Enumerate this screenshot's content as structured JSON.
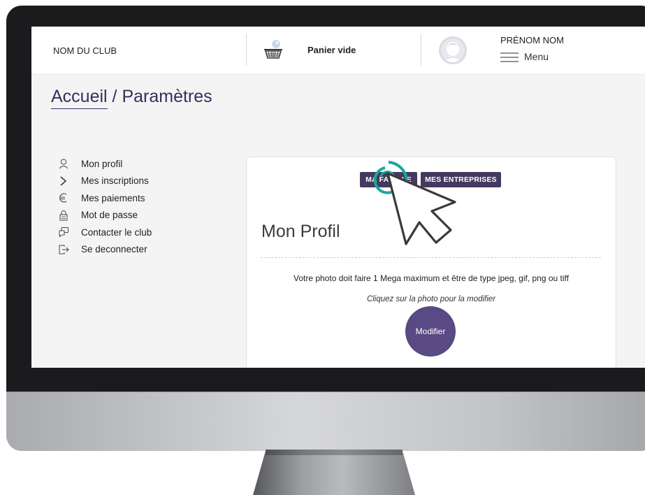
{
  "header": {
    "club_name": "NOM DU CLUB",
    "cart_label": "Panier vide",
    "user_name": "PRÉNOM NOM",
    "menu_label": "Menu"
  },
  "breadcrumb": {
    "home": "Accueil",
    "separator": " / ",
    "current": "Paramètres"
  },
  "sidebar": {
    "items": [
      {
        "label": "Mon profil",
        "icon": "user-icon"
      },
      {
        "label": "Mes inscriptions",
        "icon": "chevron-right-icon"
      },
      {
        "label": "Mes paiements",
        "icon": "euro-icon"
      },
      {
        "label": "Mot de passe",
        "icon": "lock-icon"
      },
      {
        "label": "Contacter le club",
        "icon": "chat-icon"
      },
      {
        "label": "Se deconnecter",
        "icon": "logout-icon"
      }
    ]
  },
  "profile": {
    "tabs": [
      "MA FAMILLE",
      "MES ENTREPRISES"
    ],
    "title": "Mon Profil",
    "photo_info": "Votre photo doit faire 1 Mega maximum et être de type jpeg, gif, png ou tiff",
    "photo_hint": "Cliquez sur la photo pour la modifier",
    "photo_button": "Modifier"
  },
  "colors": {
    "accent": "#453960",
    "photo_button": "#594984",
    "click_ring": "#1aa79a"
  }
}
